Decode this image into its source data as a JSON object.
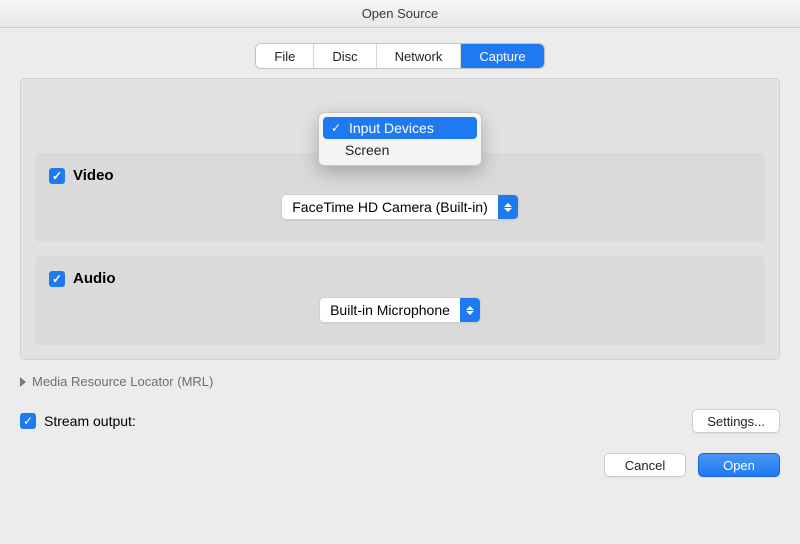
{
  "window": {
    "title": "Open Source"
  },
  "tabs": {
    "file": "File",
    "disc": "Disc",
    "network": "Network",
    "capture": "Capture",
    "active": "capture"
  },
  "popup": {
    "item_input_devices": "Input Devices",
    "item_screen": "Screen",
    "selected": "Input Devices"
  },
  "video": {
    "label": "Video",
    "checked": true,
    "selected_device": "FaceTime HD Camera (Built-in)"
  },
  "audio": {
    "label": "Audio",
    "checked": true,
    "selected_device": "Built-in Microphone"
  },
  "mrl": {
    "label": "Media Resource Locator (MRL)"
  },
  "stream": {
    "label": "Stream output:",
    "checked": true,
    "settings_btn": "Settings..."
  },
  "footer": {
    "cancel": "Cancel",
    "open": "Open"
  }
}
